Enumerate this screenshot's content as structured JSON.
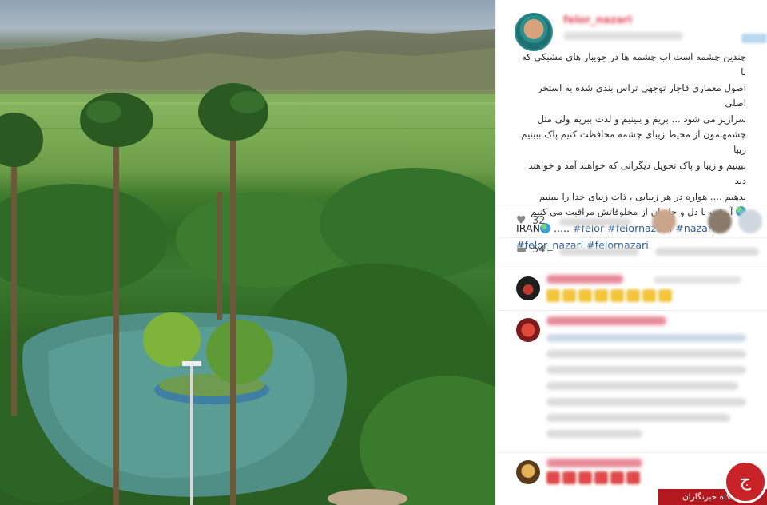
{
  "post": {
    "caption_lines": [
      "چندین چشمه است اب چشمه ها در جویبار های مشبکی که با",
      "اصول معماری قاجار توجهی تراس بندی شده به استخر اصلی",
      "سرازیر می شود ... بریم و ببینیم و لذت ببریم ولی مثل",
      "چشمهامون از محیط زیبای چشمه محافظت کنیم پاک ببینیم زیبا",
      "ببینیم و زیبا و پاک تحویل دیگرانی که خواهند آمد و خواهند دید",
      "بدهیم .... هواره در هر زیبایی ، ذات زیبای خدا را ببینیم",
      "آنوقت با دل و جانمان از مخلوقاتش مراقبت می کنیم"
    ],
    "hashtag_line1_prefix": "IRAN",
    "hashtag_line1_dots": ".....",
    "hashtag_line1_tags": "#felor #felornazarii #nazari",
    "hashtag_line2_tags": "#felor_nazari #felornazari",
    "likes_count": "32",
    "comments_count": "54"
  },
  "icons": {
    "like": "heart-icon",
    "comment": "comment-icon",
    "caption_emoji": "globe-icon"
  },
  "watermark": {
    "label": "باشگاه خبرنگاران",
    "logo_glyph": "ج"
  },
  "colors": {
    "username": "#e04a5e",
    "hashtag": "#2f5f9a",
    "watermark": "#b31a1f",
    "stars": "#f2c53d"
  }
}
